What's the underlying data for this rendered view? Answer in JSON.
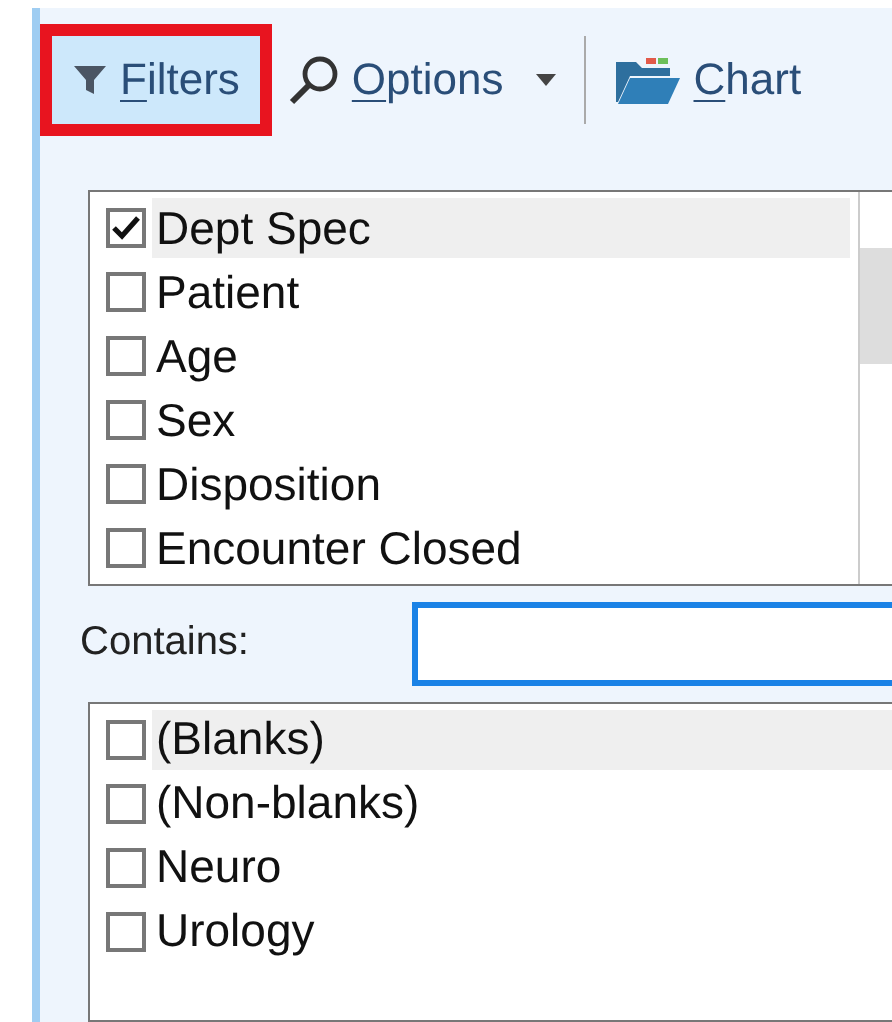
{
  "toolbar": [
    {
      "kind": "filter",
      "label": "Filters",
      "highlighted": true,
      "selected": true,
      "dropdown": false
    },
    {
      "kind": "search",
      "label": "Options",
      "highlighted": false,
      "selected": false,
      "dropdown": true
    },
    {
      "kind": "folder",
      "label": "Chart",
      "highlighted": false,
      "selected": false,
      "dropdown": false
    }
  ],
  "fields_list": {
    "items": [
      {
        "label": "Dept Spec",
        "checked": true,
        "selected": true
      },
      {
        "label": "Patient",
        "checked": false,
        "selected": false
      },
      {
        "label": "Age",
        "checked": false,
        "selected": false
      },
      {
        "label": "Sex",
        "checked": false,
        "selected": false
      },
      {
        "label": "Disposition",
        "checked": false,
        "selected": false
      },
      {
        "label": "Encounter Closed",
        "checked": false,
        "selected": false
      }
    ]
  },
  "contains": {
    "label": "Contains:"
  },
  "values_list": {
    "items": [
      {
        "label": "(Blanks)",
        "checked": false,
        "selected": true
      },
      {
        "label": "(Non-blanks)",
        "checked": false,
        "selected": false
      },
      {
        "label": "Neuro",
        "checked": false,
        "selected": false
      },
      {
        "label": "Urology",
        "checked": false,
        "selected": false
      }
    ]
  }
}
